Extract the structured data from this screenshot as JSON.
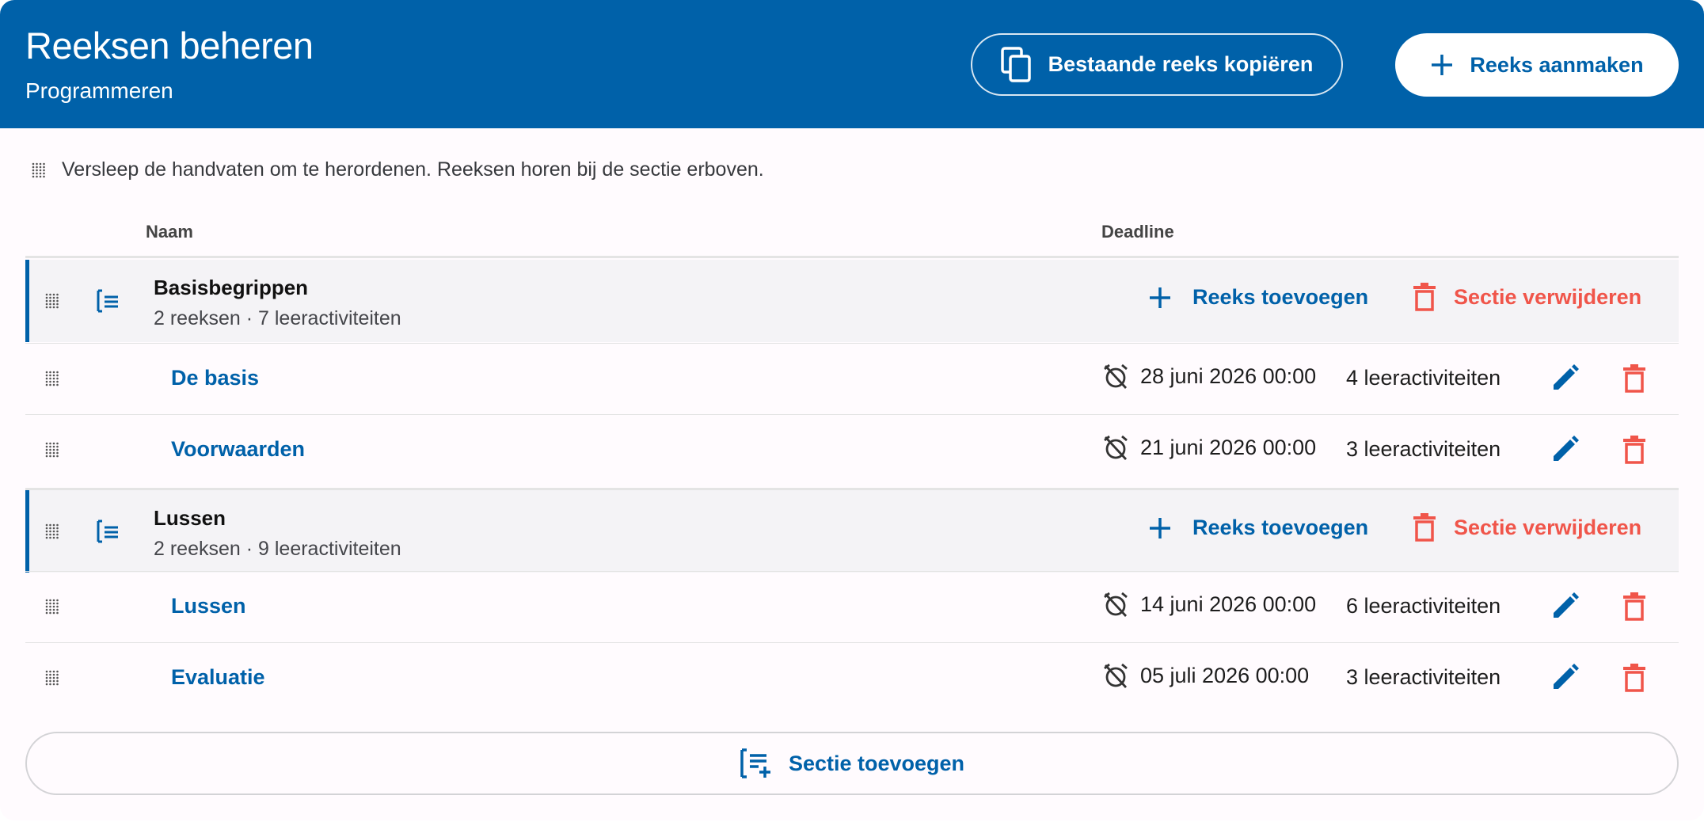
{
  "header": {
    "title": "Reeksen beheren",
    "subtitle": "Programmeren",
    "copy_button": "Bestaande reeks kopiëren",
    "create_button": "Reeks aanmaken"
  },
  "hint": "Versleep de handvaten om te herordenen. Reeksen horen bij de sectie erboven.",
  "columns": {
    "name": "Naam",
    "deadline": "Deadline"
  },
  "sections": [
    {
      "name": "Basisbegrippen",
      "meta": "2 reeksen · 7 leeractiviteiten",
      "add_label": "Reeks toevoegen",
      "delete_label": "Sectie verwijderen",
      "items": [
        {
          "name": "De basis",
          "deadline": "28 juni 2026 00:00",
          "activities": "4 leeractiviteiten"
        },
        {
          "name": "Voorwaarden",
          "deadline": "21 juni 2026 00:00",
          "activities": "3 leeractiviteiten"
        }
      ]
    },
    {
      "name": "Lussen",
      "meta": "2 reeksen · 9 leeractiviteiten",
      "add_label": "Reeks toevoegen",
      "delete_label": "Sectie verwijderen",
      "items": [
        {
          "name": "Lussen",
          "deadline": "14 juni 2026 00:00",
          "activities": "6 leeractiviteiten"
        },
        {
          "name": "Evaluatie",
          "deadline": "05 juli 2026 00:00",
          "activities": "3 leeractiviteiten"
        }
      ]
    }
  ],
  "add_section_label": "Sectie toevoegen",
  "colors": {
    "primary": "#0061a9",
    "danger": "#f0554a",
    "section_bg": "#f4f3f6"
  },
  "icons": {
    "handle": "drag-handle-icon",
    "section": "section-list-icon",
    "alarm": "alarm-off-icon",
    "edit": "pencil-icon",
    "delete": "trash-icon",
    "copy": "copy-icon",
    "plus": "plus-icon",
    "add_section": "playlist-add-icon"
  }
}
